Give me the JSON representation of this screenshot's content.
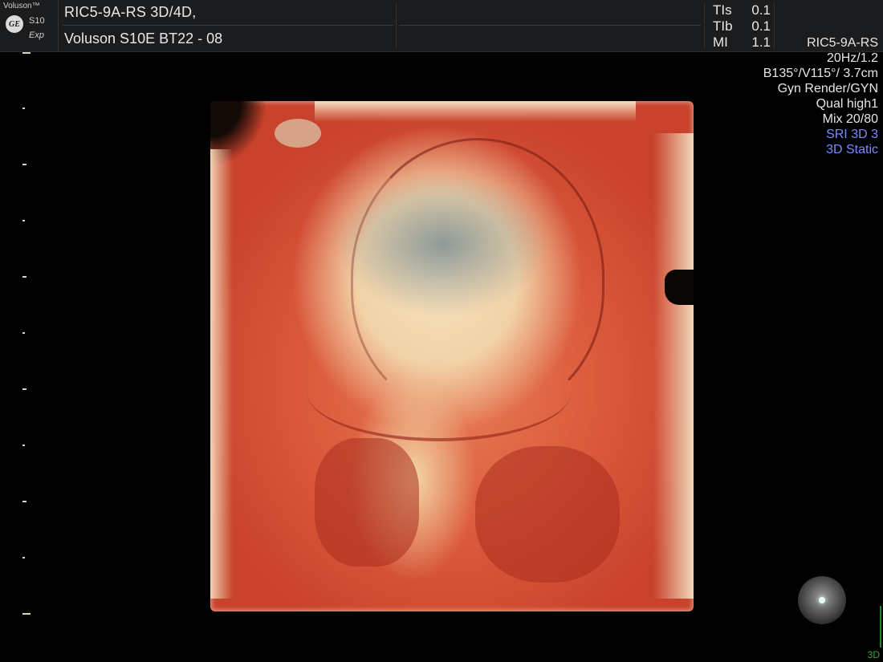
{
  "header": {
    "brand": "Voluson™",
    "logo_text": "GE",
    "model": "S10",
    "mode": "Exp",
    "probe_mode": "RIC5-9A-RS 3D/4D,",
    "system": "Voluson S10E BT22 - 08",
    "params": [
      {
        "label": "TIs",
        "value": "0.1"
      },
      {
        "label": "TIb",
        "value": "0.1"
      },
      {
        "label": "MI",
        "value": "1.1"
      }
    ]
  },
  "info_panel": {
    "probe": "RIC5-9A-RS",
    "frame_rate": "20Hz/1.2",
    "angles_depth": "B135°/V115°/ 3.7cm",
    "render_mode": "Gyn Render/GYN",
    "quality": "Qual high1",
    "mix": "Mix 20/80",
    "sri": "SRI 3D 3",
    "acquisition": "3D Static"
  },
  "colors": {
    "accent_blue": "#7a8cff",
    "indicator_green": "#3aa14a",
    "render_tissue": "#db5a3c",
    "render_highlight": "#f6e0bd"
  },
  "view_indicator": "3D"
}
